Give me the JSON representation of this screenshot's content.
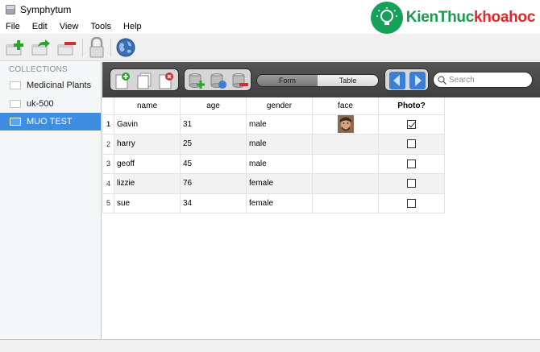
{
  "window": {
    "title": "Symphytum"
  },
  "watermark": {
    "part1": "Kien",
    "part2": "Thuc",
    "part3": "khoahoc"
  },
  "menu": [
    "File",
    "Edit",
    "View",
    "Tools",
    "Help"
  ],
  "toolbar": {
    "icons": [
      "new-collection-icon",
      "duplicate-collection-icon",
      "delete-collection-icon",
      "lock-icon",
      "globe-icon"
    ]
  },
  "sidebar": {
    "header": "COLLECTIONS",
    "items": [
      {
        "label": "Medicinal Plants",
        "selected": false
      },
      {
        "label": "uk-500",
        "selected": false
      },
      {
        "label": "MUO TEST",
        "selected": true
      }
    ]
  },
  "view_toolbar": {
    "form_label": "Form",
    "table_label": "Table",
    "active_view": "Table",
    "search_placeholder": "Search"
  },
  "table": {
    "columns": [
      "name",
      "age",
      "gender",
      "face",
      "Photo?"
    ],
    "rows": [
      {
        "num": "1",
        "name": "Gavin",
        "age": "31",
        "gender": "male",
        "face": "face-image",
        "photo": true
      },
      {
        "num": "2",
        "name": "harry",
        "age": "25",
        "gender": "male",
        "face": "",
        "photo": false
      },
      {
        "num": "3",
        "name": "geoff",
        "age": "45",
        "gender": "male",
        "face": "",
        "photo": false
      },
      {
        "num": "4",
        "name": "lizzie",
        "age": "76",
        "gender": "female",
        "face": "",
        "photo": false
      },
      {
        "num": "5",
        "name": "sue",
        "age": "34",
        "gender": "female",
        "face": "",
        "photo": false
      }
    ]
  },
  "colors": {
    "selection": "#3d8ee0",
    "toolbar_dark": "#4a4a4a",
    "nav_arrow": "#3b7fd4",
    "watermark_green": "#1b9a4f",
    "watermark_red": "#e4262b"
  }
}
